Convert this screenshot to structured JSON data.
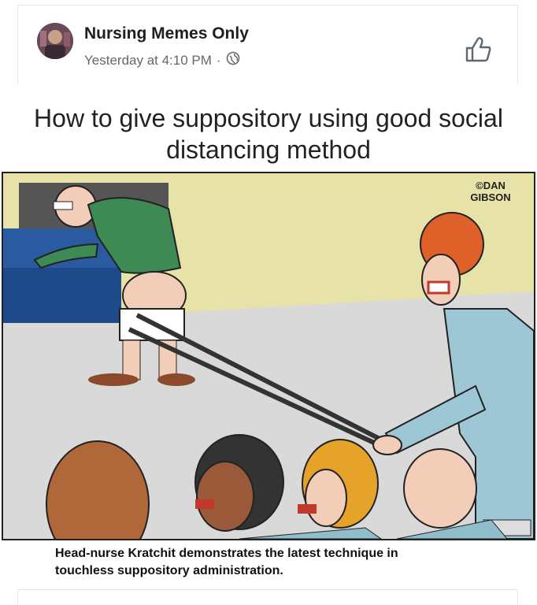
{
  "post": {
    "page_name": "Nursing Memes Only",
    "timestamp": "Yesterday at 4:10 PM",
    "separator": "·",
    "audience_icon": "globe-icon",
    "action_icon": "thumbs-up-icon"
  },
  "meme": {
    "title_line1": "How to give suppository using good social",
    "title_line2": "distancing method",
    "signature": "©DAN GIBSON",
    "caption_line1": "Head-nurse Kratchit demonstrates the latest technique in",
    "caption_line2": "touchless suppository administration."
  },
  "colors": {
    "accent": "#1877f2",
    "text_secondary": "#65676b",
    "scrub_blue": "#9ec7d6",
    "patient_shirt": "#3e8a55",
    "nurse_hair": "#e0602a"
  }
}
